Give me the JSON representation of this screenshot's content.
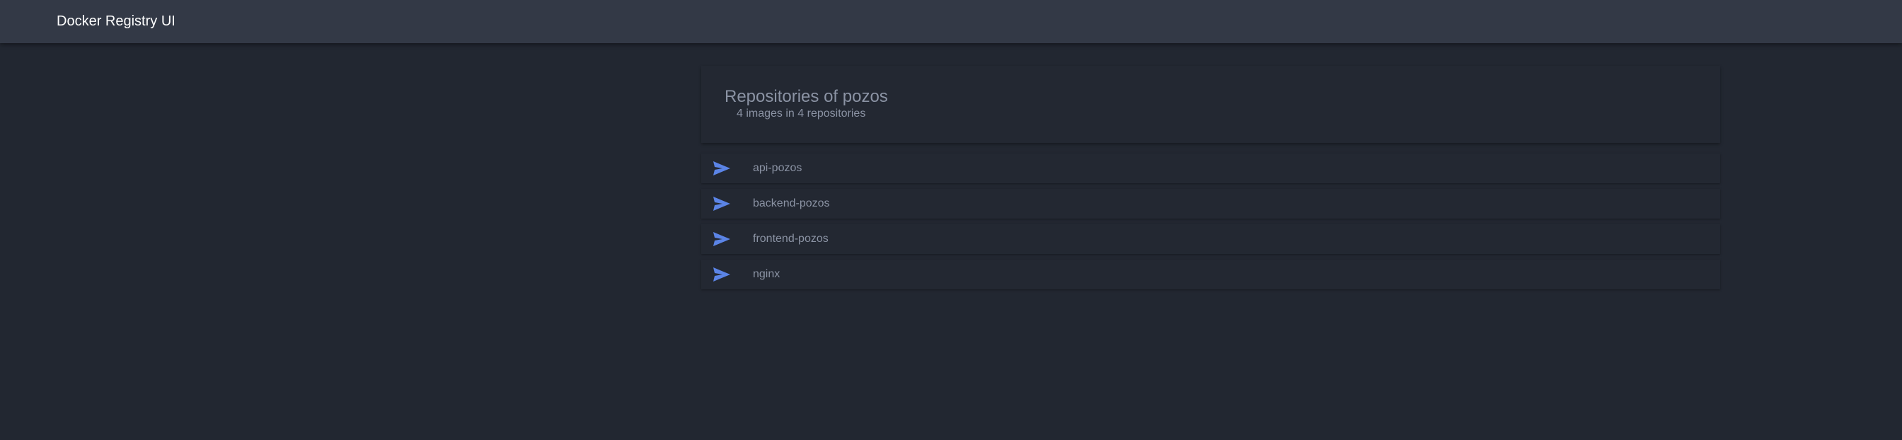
{
  "app": {
    "title": "Docker Registry UI"
  },
  "header": {
    "title": "Repositories of pozos",
    "subtitle": "4 images in 4 repositories"
  },
  "repositories": [
    {
      "name": "api-pozos"
    },
    {
      "name": "backend-pozos"
    },
    {
      "name": "frontend-pozos"
    },
    {
      "name": "nginx"
    }
  ],
  "icons": {
    "repo": "send-icon"
  },
  "colors": {
    "topbar": "#333946",
    "background": "#222731",
    "card": "#232832",
    "accent": "#5b84e6",
    "text": "#8b93a4"
  }
}
